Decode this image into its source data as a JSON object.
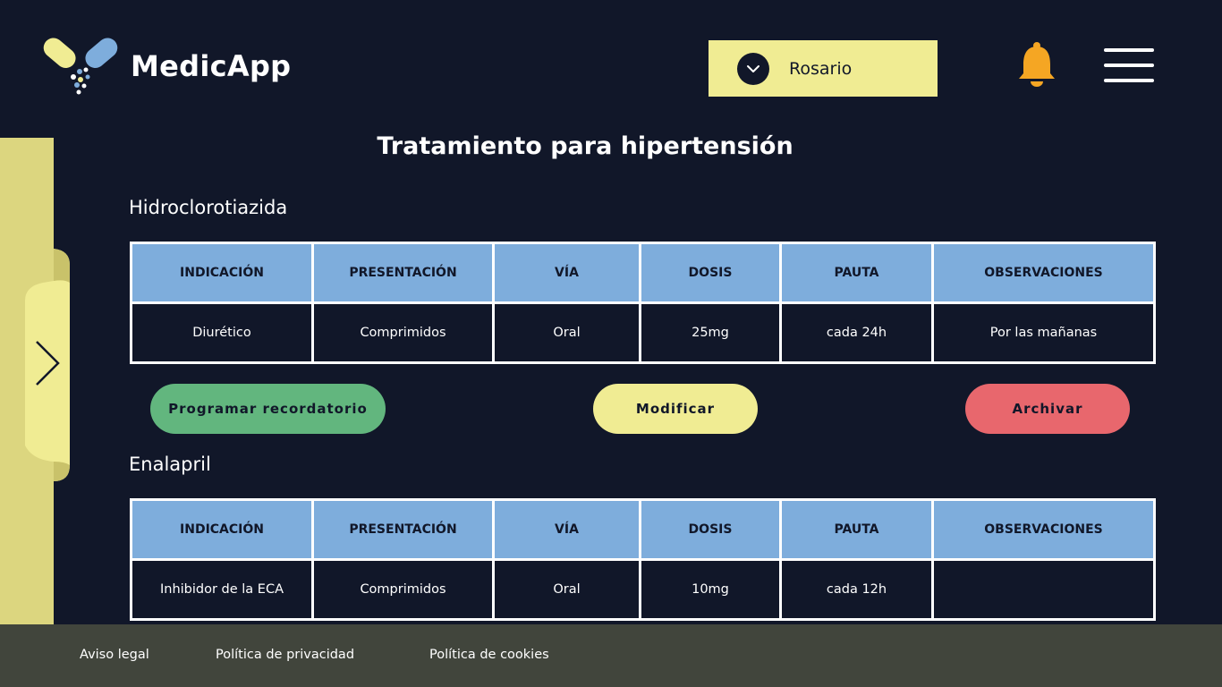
{
  "header": {
    "app_name": "MedicApp",
    "user": "Rosario"
  },
  "page": {
    "title": "Tratamiento para hipertensión"
  },
  "table_headers": [
    "INDICACIÓN",
    "PRESENTACIÓN",
    "VÍA",
    "DOSIS",
    "PAUTA",
    "OBSERVACIONES"
  ],
  "medications": [
    {
      "name": "Hidroclorotiazida",
      "row": [
        "Diurético",
        "Comprimidos",
        "Oral",
        "25mg",
        "cada 24h",
        "Por las mañanas"
      ]
    },
    {
      "name": "Enalapril",
      "row": [
        "Inhibidor de la ECA",
        "Comprimidos",
        "Oral",
        "10mg",
        "cada 12h",
        ""
      ]
    }
  ],
  "actions": {
    "remind": "Programar recordatorio",
    "modify": "Modificar",
    "archive": "Archivar"
  },
  "footer": {
    "legal": "Aviso legal",
    "privacy": "Política de privacidad",
    "cookies": "Política de cookies"
  },
  "colors": {
    "background": "#111729",
    "accent_yellow": "#f0ec93",
    "header_blue": "#7eaddc",
    "green": "#62b67e",
    "red": "#e8676d",
    "bell": "#f5a623"
  },
  "icons": [
    "pill-logo-icon",
    "chevron-down-icon",
    "bell-icon",
    "hamburger-menu-icon",
    "chevron-right-icon"
  ]
}
